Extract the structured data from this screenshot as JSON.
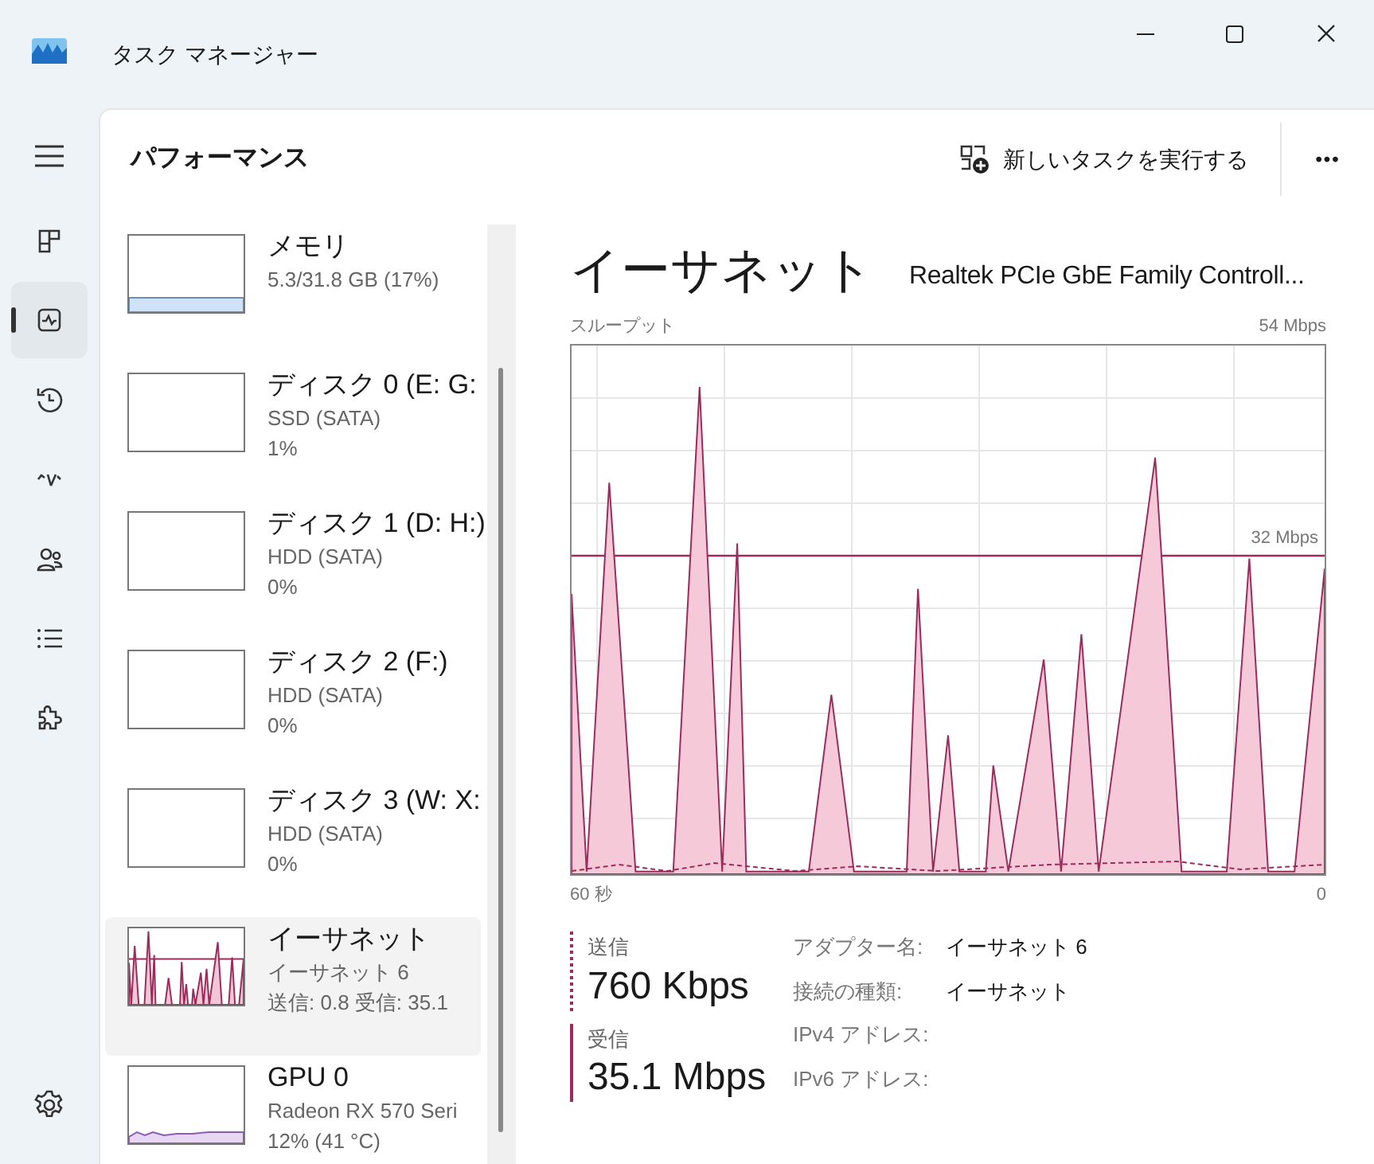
{
  "window": {
    "title": "タスク マネージャー"
  },
  "nav_items": [
    {
      "selected": false
    },
    {
      "selected": true
    },
    {
      "selected": false
    },
    {
      "selected": false
    },
    {
      "selected": false
    },
    {
      "selected": false
    },
    {
      "selected": false
    }
  ],
  "header": {
    "title": "パフォーマンス",
    "run_task": "新しいタスクを実行する",
    "more": "•••"
  },
  "devices": [
    {
      "kind": "memory",
      "name": "メモリ",
      "lines": [
        "5.3/31.8 GB (17%)"
      ],
      "selected": false
    },
    {
      "kind": "disk",
      "name": "ディスク 0 (E: G:",
      "lines": [
        "SSD (SATA)",
        "1%"
      ],
      "selected": false
    },
    {
      "kind": "disk",
      "name": "ディスク 1 (D: H:)",
      "lines": [
        "HDD (SATA)",
        "0%"
      ],
      "selected": false
    },
    {
      "kind": "disk",
      "name": "ディスク 2 (F:)",
      "lines": [
        "HDD (SATA)",
        "0%"
      ],
      "selected": false
    },
    {
      "kind": "disk",
      "name": "ディスク 3 (W: X:",
      "lines": [
        "HDD (SATA)",
        "0%"
      ],
      "selected": false
    },
    {
      "kind": "network",
      "name": "イーサネット",
      "lines": [
        "イーサネット 6",
        "送信: 0.8 受信: 35.1"
      ],
      "selected": true
    },
    {
      "kind": "gpu",
      "name": "GPU 0",
      "lines": [
        "Radeon RX 570 Seri",
        "12% (41 °C)"
      ],
      "selected": false
    }
  ],
  "detail": {
    "title": "イーサネット",
    "adapter": "Realtek PCIe GbE Family Controll...",
    "graph": {
      "label": "スループット",
      "max": "54 Mbps",
      "marker": "32 Mbps",
      "x_start": "60 秒",
      "x_end": "0"
    },
    "send": {
      "label": "送信",
      "value": "760 Kbps"
    },
    "receive": {
      "label": "受信",
      "value": "35.1 Mbps"
    },
    "properties": [
      {
        "label": "アダプター名:",
        "value": "イーサネット 6"
      },
      {
        "label": "接続の種類:",
        "value": "イーサネット"
      },
      {
        "label": "IPv4 アドレス:"
      },
      {
        "label": "IPv6 アドレス:"
      }
    ]
  }
}
